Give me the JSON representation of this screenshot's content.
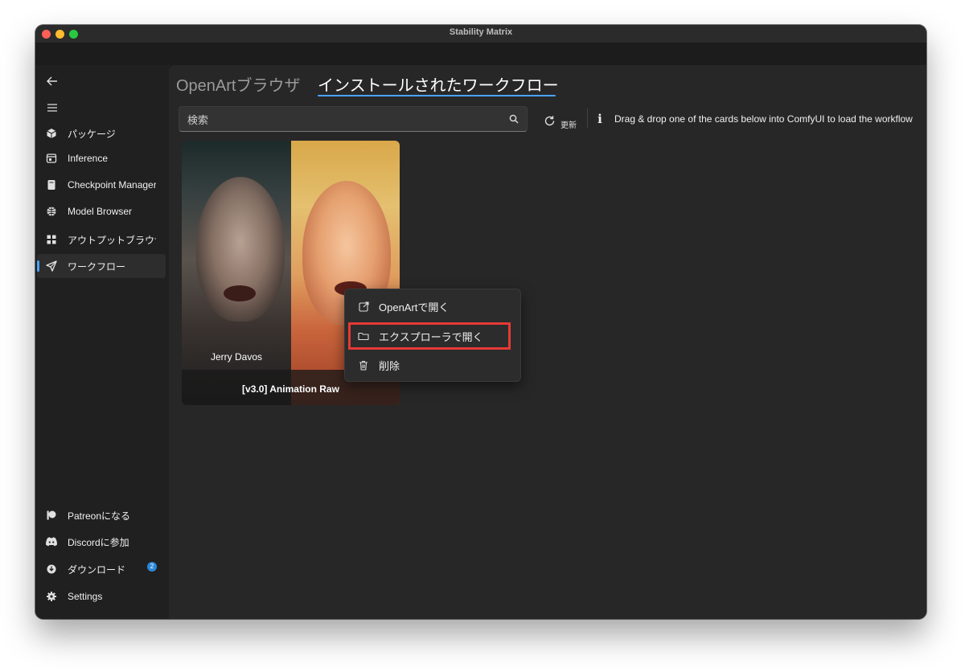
{
  "window": {
    "title": "Stability Matrix"
  },
  "sidebar": {
    "items": [
      {
        "label": "パッケージ",
        "icon": "package-icon"
      },
      {
        "label": "Inference",
        "icon": "inference-icon"
      },
      {
        "label": "Checkpoint Manager",
        "icon": "checkpoint-icon"
      },
      {
        "label": "Model Browser",
        "icon": "model-browser-icon"
      },
      {
        "label": "アウトプットブラウザ",
        "icon": "grid-icon"
      },
      {
        "label": "ワークフロー",
        "icon": "send-icon"
      }
    ],
    "footer": [
      {
        "label": "Patreonになる",
        "icon": "patreon-icon"
      },
      {
        "label": "Discordに参加",
        "icon": "discord-icon"
      },
      {
        "label": "ダウンロード",
        "icon": "download-icon",
        "badge": "2"
      },
      {
        "label": "Settings",
        "icon": "gear-icon"
      }
    ]
  },
  "tabs": {
    "openart": "OpenArtブラウザ",
    "installed": "インストールされたワークフロー"
  },
  "search": {
    "placeholder": "検索"
  },
  "toolbar": {
    "refresh_label": "更新",
    "info_text": "Drag & drop one of the cards below into ComfyUI to load the workflow"
  },
  "card": {
    "author": "Jerry Davos",
    "title": "[v3.0] Animation Raw"
  },
  "context_menu": {
    "items": [
      {
        "label": "OpenArtで開く",
        "icon": "external-link-icon"
      },
      {
        "label": "エクスプローラで開く",
        "icon": "folder-icon",
        "highlighted": true
      },
      {
        "label": "削除",
        "icon": "trash-icon"
      }
    ]
  },
  "colors": {
    "accent": "#4aa3ff",
    "highlight": "#e53935",
    "background": "#272727"
  }
}
